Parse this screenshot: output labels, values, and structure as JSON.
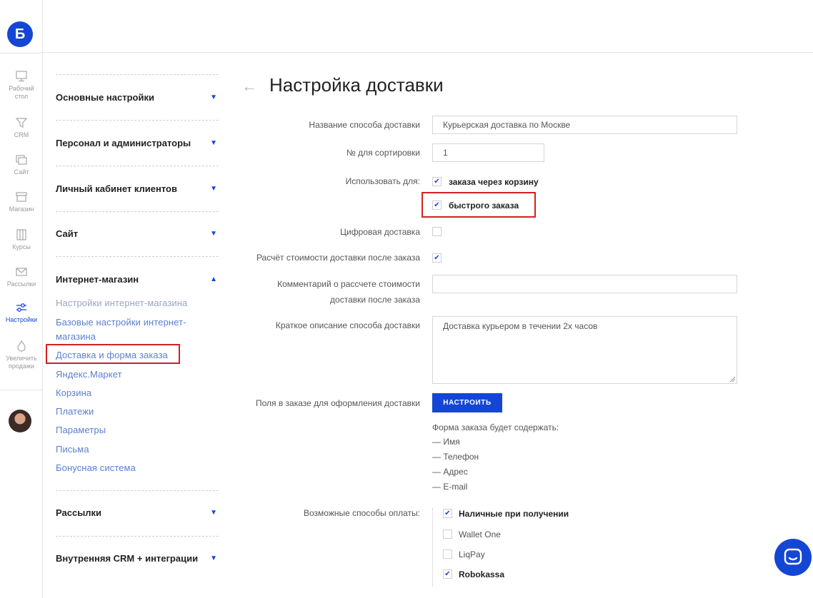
{
  "rail": {
    "logo": "Б",
    "items": [
      {
        "label": "Рабочий стол",
        "icon": "desktop-icon"
      },
      {
        "label": "CRM",
        "icon": "funnel-icon"
      },
      {
        "label": "Сайт",
        "icon": "site-icon"
      },
      {
        "label": "Магазин",
        "icon": "store-icon"
      },
      {
        "label": "Курсы",
        "icon": "courses-icon"
      },
      {
        "label": "Рассылки",
        "icon": "mail-icon"
      },
      {
        "label": "Настройки",
        "icon": "sliders-icon"
      },
      {
        "label": "Увеличить продажи",
        "icon": "flame-icon"
      }
    ]
  },
  "sidebar": {
    "sections": [
      {
        "label": "Основные настройки",
        "expanded": false
      },
      {
        "label": "Персонал и администраторы",
        "expanded": false
      },
      {
        "label": "Личный кабинет клиентов",
        "expanded": false
      },
      {
        "label": "Сайт",
        "expanded": false
      },
      {
        "label": "Интернет-магазин",
        "expanded": true
      },
      {
        "label": "Рассылки",
        "expanded": false
      },
      {
        "label": "Внутренняя CRM + интеграции",
        "expanded": false
      }
    ],
    "shop_items": [
      "Настройки интернет-магазина",
      "Базовые настройки интернет-",
      "магазина",
      "Доставка и форма заказа",
      "Яндекс.Маркет",
      "Корзина",
      "Платежи",
      "Параметры",
      "Письма",
      "Бонусная система"
    ]
  },
  "main": {
    "title": "Настройка доставки",
    "fields": {
      "name_label": "Название способа доставки",
      "name_value": "Курьерская доставка по Москве",
      "sort_label": "№ для сортировки",
      "sort_value": "1",
      "use_for_label": "Использовать для:",
      "use_cart_label": "заказа через корзину",
      "use_quick_label": "быстрого заказа",
      "digital_label": "Цифровая доставка",
      "calc_after_label": "Расчёт стоимости доставки после заказа",
      "comment_label_1": "Комментарий о рассчете стоимости",
      "comment_label_2": "доставки после заказа",
      "comment_value": "",
      "desc_label": "Краткое описание способа доставки",
      "desc_value": "Доставка курьером в течении 2х часов",
      "order_fields_label": "Поля в заказе для оформления доставки",
      "configure_button": "НАСТРОИТЬ",
      "form_intro": "Форма заказа будет содержать:",
      "form_items": [
        "— Имя",
        "— Телефон",
        "— Адрес",
        "— E-mail"
      ],
      "payment_label": "Возможные способы оплаты:",
      "payments": [
        {
          "label": "Наличные при получении",
          "checked": true
        },
        {
          "label": "Wallet One",
          "checked": false
        },
        {
          "label": "LiqPay",
          "checked": false
        },
        {
          "label": "Robokassa",
          "checked": true
        }
      ]
    },
    "checkbox_states": {
      "cart": true,
      "quick": true,
      "digital": false,
      "calc_after": true
    },
    "check_glyph": "✔",
    "back_glyph": "←"
  },
  "colors": {
    "accent": "#1446d6",
    "highlight": "#d42020",
    "link": "#5b7fcf"
  }
}
